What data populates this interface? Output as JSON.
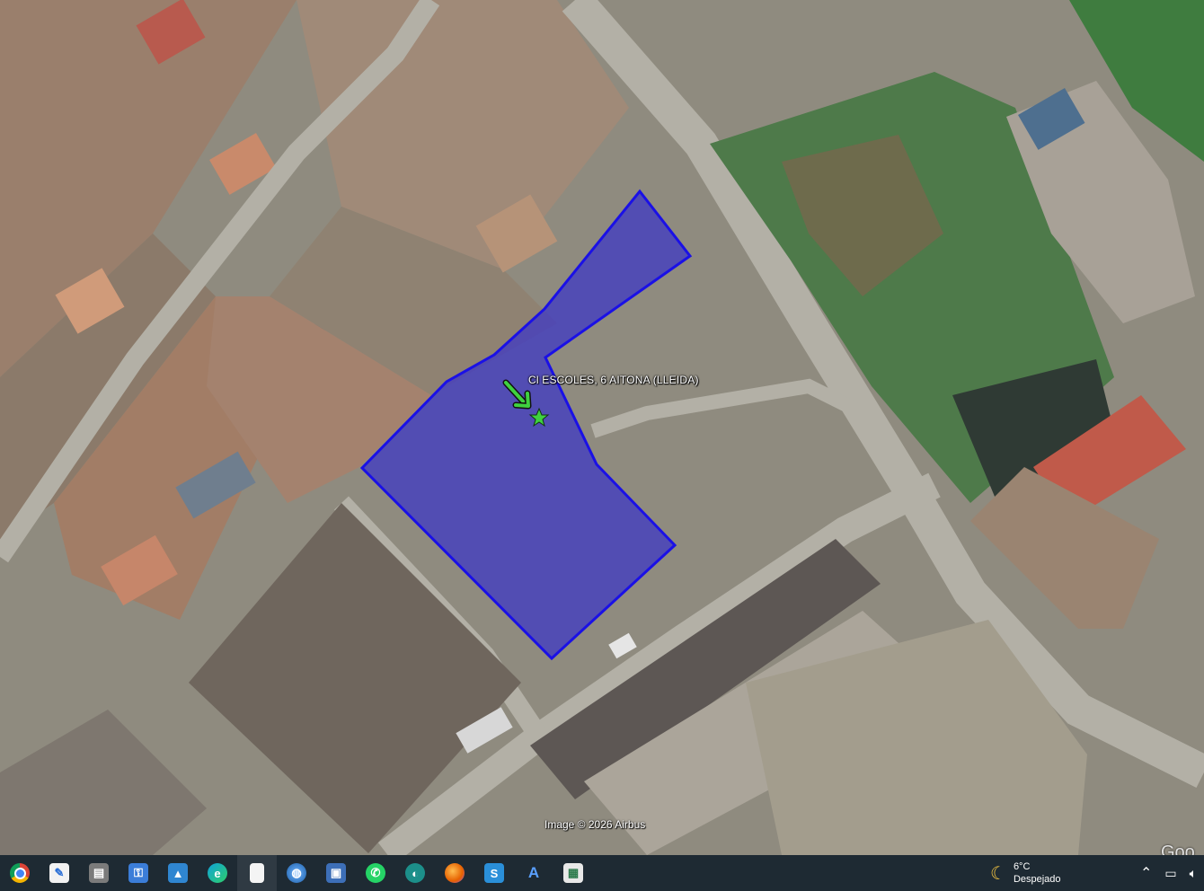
{
  "map": {
    "placemark_label": "Cl ESCOLES, 6  AITONA (LLEIDA)",
    "attribution": "Image © 2026 Airbus",
    "logo_text": "Goo",
    "parcel_fill_color": "#3a34c8",
    "parcel_stroke_color": "#1a10e6",
    "arrow_color": "#3fd13f"
  },
  "taskbar": {
    "icons": [
      "chrome-icon",
      "paint-icon",
      "file-explorer-icon",
      "photos-icon",
      "image-viewer-icon",
      "edge-icon",
      "file-icon",
      "earth-icon",
      "floppy-save-icon",
      "whatsapp-icon",
      "app-icon",
      "firefox-icon",
      "skype-icon",
      "acrobat-icon",
      "window-icon"
    ],
    "weather": {
      "temperature": "6°C",
      "condition": "Despejado"
    },
    "tray": {
      "chevron": "^",
      "network": "network-icon",
      "volume": "volume-icon"
    }
  }
}
